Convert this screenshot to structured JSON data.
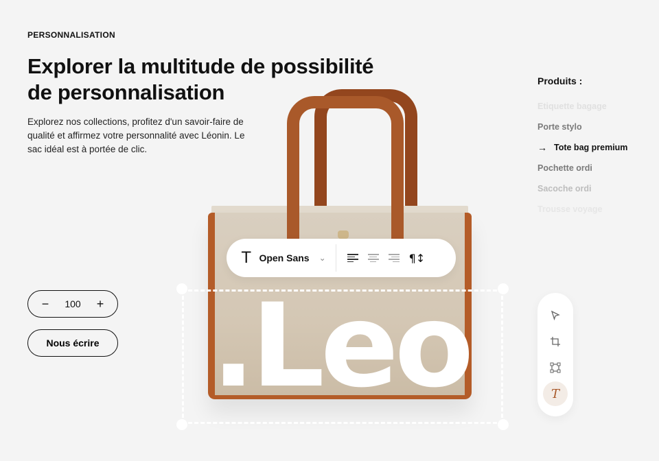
{
  "section_label": "PERSONNALISATION",
  "title": "Explorer la multitude de possibilité de personnalisation",
  "description": "Explorez nos collections, profitez d'un savoir-faire de qualité et affirmez votre personnalité avec Léonin. Le sac idéal est à portée de clic.",
  "quantity": {
    "minus": "−",
    "value": "100",
    "plus": "+"
  },
  "contact_button": "Nous écrire",
  "products": {
    "heading": "Produits :",
    "items": [
      {
        "label": "Etiquette bagage",
        "color": "#e0e0e0"
      },
      {
        "label": "Porte stylo",
        "color": "#7a7a7a"
      },
      {
        "label": "Tote bag premium",
        "color": "#111111",
        "active": true,
        "arrow": "→"
      },
      {
        "label": "Pochette ordi",
        "color": "#7a7a7a"
      },
      {
        "label": "Sacoche ordi",
        "color": "#bdbdbd"
      },
      {
        "label": "Trousse voyage",
        "color": "#e6e6e6"
      }
    ]
  },
  "custom_text": ".Leo",
  "toolbar": {
    "font_icon": "T",
    "font_name": "Open Sans",
    "chevron": "⌄",
    "paragraph_icon": "¶↕"
  },
  "side_tools": [
    "pointer-icon",
    "crop-icon",
    "transform-icon",
    "text-icon"
  ],
  "colors": {
    "accent": "#a9592a",
    "background": "#f4f4f4"
  }
}
